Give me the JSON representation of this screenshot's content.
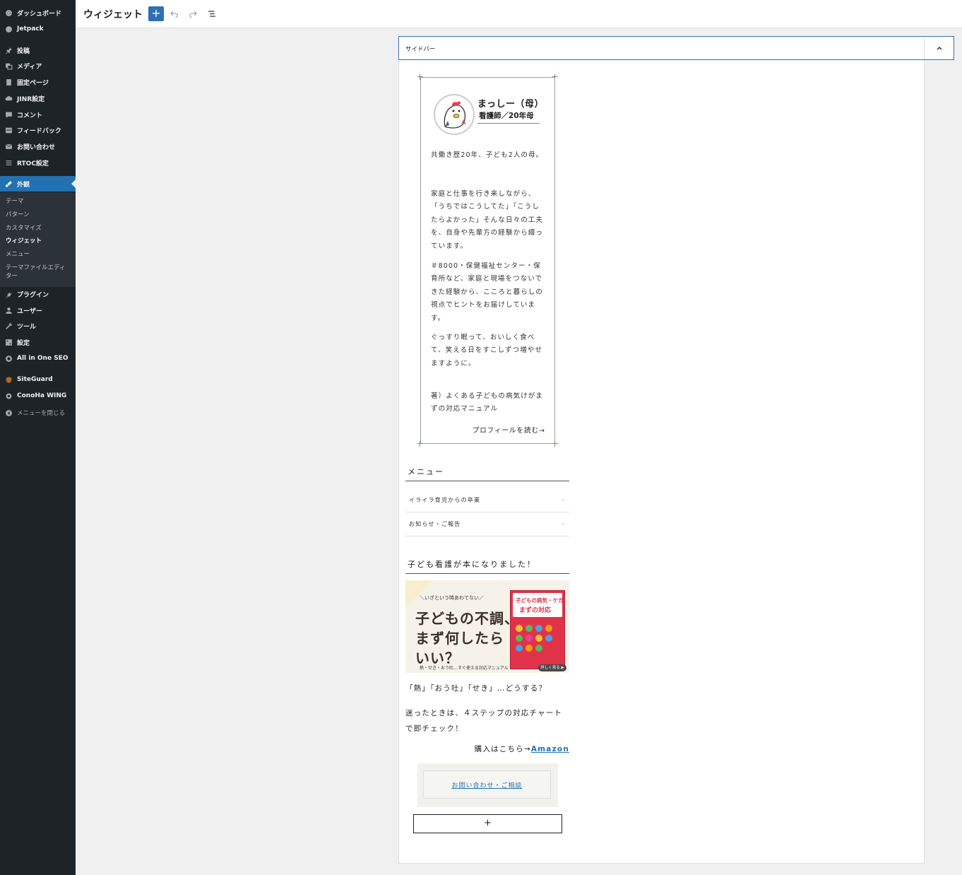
{
  "admin_menu": {
    "items": [
      {
        "label": "ダッシュボード",
        "icon": "dashboard-icon"
      },
      {
        "label": "Jetpack",
        "icon": "jetpack-icon"
      },
      {
        "label": "投稿",
        "icon": "pin-icon"
      },
      {
        "label": "メディア",
        "icon": "media-icon"
      },
      {
        "label": "固定ページ",
        "icon": "page-icon"
      },
      {
        "label": "JINR設定",
        "icon": "cloud-icon"
      },
      {
        "label": "コメント",
        "icon": "comment-icon"
      },
      {
        "label": "フィードバック",
        "icon": "feedback-icon"
      },
      {
        "label": "お問い合わせ",
        "icon": "mail-icon"
      },
      {
        "label": "RTOC設定",
        "icon": "list-icon"
      },
      {
        "label": "外観",
        "icon": "brush-icon"
      },
      {
        "label": "プラグイン",
        "icon": "plugin-icon"
      },
      {
        "label": "ユーザー",
        "icon": "user-icon"
      },
      {
        "label": "ツール",
        "icon": "wrench-icon"
      },
      {
        "label": "設定",
        "icon": "settings-icon"
      },
      {
        "label": "All in One SEO",
        "icon": "seo-icon"
      },
      {
        "label": "SiteGuard",
        "icon": "siteguard-icon"
      },
      {
        "label": "ConoHa WING",
        "icon": "gear-icon"
      },
      {
        "label": "メニューを閉じる",
        "icon": "collapse-icon"
      }
    ],
    "submenu": [
      "テーマ",
      "パターン",
      "カスタマイズ",
      "ウィジェット",
      "メニュー",
      "テーマファイルエディター"
    ]
  },
  "header": {
    "title": "ウィジェット",
    "add_label": "+"
  },
  "widget_area": {
    "title": "サイドバー"
  },
  "profile": {
    "name": "まっしー（母）",
    "job": "看護師／20年母",
    "p1": "共働き歴20年、子ども2人の母。",
    "p2": "家庭と仕事を行き来しながら、「うちではこうしてた」「こうしたらよかった」そんな日々の工夫を、自身や先輩方の経験から綴っています。",
    "p3": "＃8000・保健福祉センター・保育所など、家庭と現場をつないできた経験から、こころと暮らしの視点でヒントをお届けしています。",
    "p4": "ぐっすり眠って、おいしく食べて、笑える日をすこしずつ増やせますように。",
    "p5": "著）よくある子どもの病気けがまずの対応マニュアル",
    "link": "プロフィールを読む→"
  },
  "menu_widget": {
    "title": "メニュー",
    "items": [
      "イライラ育児からの卒業",
      "お知らせ・ご報告"
    ]
  },
  "book_widget": {
    "title": "子ども看護が本になりました！",
    "banner_small": "＼いざという時あわてない／",
    "banner_line1": "子どもの不調、",
    "banner_line2": "まず何したら",
    "banner_line3": "いい？",
    "banner_foot": "熱・せき・おう吐…すぐ使える対応マニュアル",
    "cover_line1": "子どもの病気・ケガ",
    "cover_line2": "まずの対応",
    "cover_button": "詳しく見る ▶",
    "text1": "「熱」「おう吐」「せき」…どうする？",
    "text2": "迷ったときは、４ステップの対応チャートで即チェック！",
    "buy_prefix": "購入はこちら→",
    "buy_link": "Amazon"
  },
  "contact": {
    "label": "お問い合わせ・ご相談"
  },
  "add_block": {
    "label": "+"
  },
  "colors": {
    "admin_bg": "#1d2327",
    "accent": "#2271b1",
    "link": "#2271b1"
  }
}
